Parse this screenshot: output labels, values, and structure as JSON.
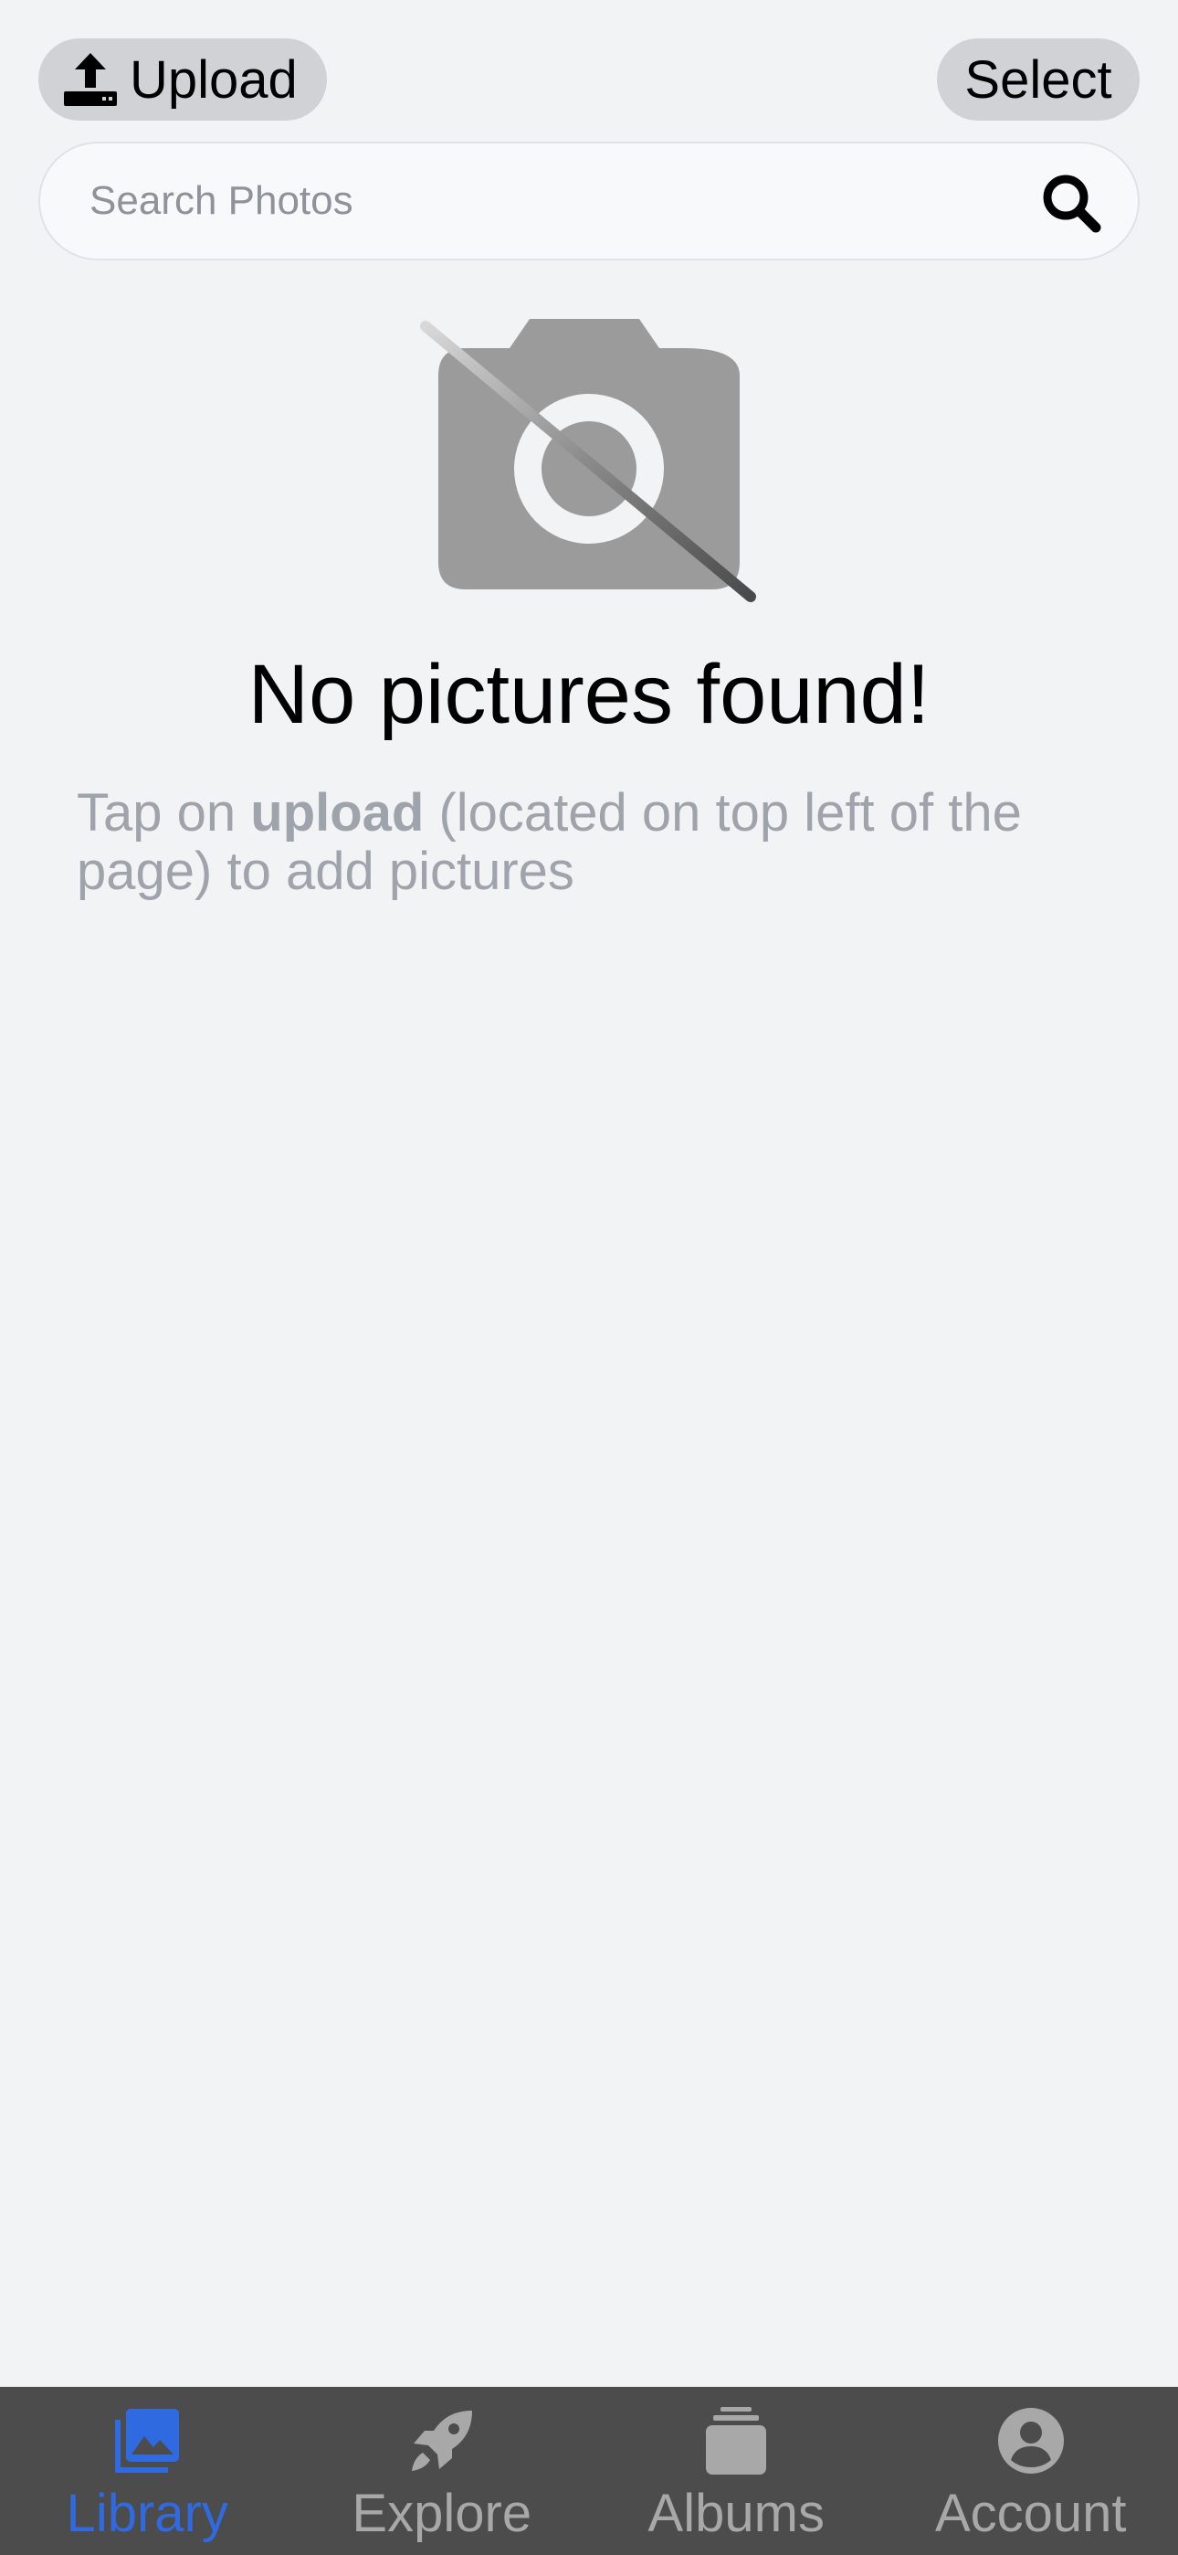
{
  "header": {
    "upload_label": "Upload",
    "select_label": "Select"
  },
  "search": {
    "placeholder": "Search Photos"
  },
  "empty_state": {
    "title": "No pictures found!",
    "hint_prefix": "Tap on ",
    "hint_bold": "upload",
    "hint_suffix": " (located on top left of the page) to add pictures"
  },
  "tabs": [
    {
      "label": "Library",
      "icon": "photo-library-icon",
      "active": true
    },
    {
      "label": "Explore",
      "icon": "rocket-icon",
      "active": false
    },
    {
      "label": "Albums",
      "icon": "albums-stack-icon",
      "active": false
    },
    {
      "label": "Account",
      "icon": "account-circle-icon",
      "active": false
    }
  ],
  "colors": {
    "background": "#f2f3f5",
    "pill_button": "#d1d2d6",
    "tab_bar": "#4c4c4c",
    "tab_active": "#2f6ae0",
    "tab_inactive": "#a8a8a8",
    "hint_text": "#9fa3ab"
  }
}
